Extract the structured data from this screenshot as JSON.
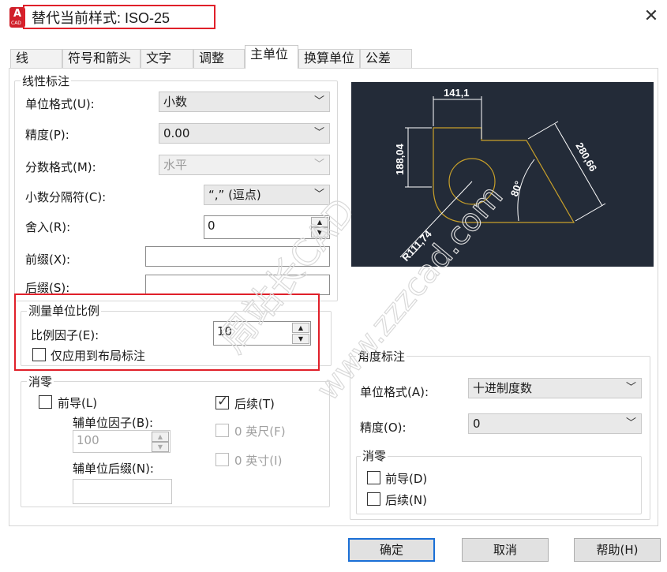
{
  "window": {
    "title": "替代当前样式: ISO-25",
    "app_icon_letter": "A",
    "app_icon_sub": "CAD",
    "close_glyph": "✕"
  },
  "tabs": [
    {
      "label": "线",
      "active": false
    },
    {
      "label": "符号和箭头",
      "active": false
    },
    {
      "label": "文字",
      "active": false
    },
    {
      "label": "调整",
      "active": false
    },
    {
      "label": "主单位",
      "active": true
    },
    {
      "label": "换算单位",
      "active": false
    },
    {
      "label": "公差",
      "active": false
    }
  ],
  "linear": {
    "title": "线性标注",
    "unit_format": {
      "label": "单位格式(U):",
      "value": "小数"
    },
    "precision": {
      "label": "精度(P):",
      "value": "0.00"
    },
    "fraction_format": {
      "label": "分数格式(M):",
      "value": "水平"
    },
    "decimal_separator": {
      "label": "小数分隔符(C):",
      "value": "“,” (逗点)"
    },
    "round_off": {
      "label": "舍入(R):",
      "value": "0"
    },
    "prefix": {
      "label": "前缀(X):",
      "value": ""
    },
    "suffix": {
      "label": "后缀(S):",
      "value": ""
    }
  },
  "scale": {
    "title": "测量单位比例",
    "factor": {
      "label": "比例因子(E):",
      "value": "10"
    },
    "layout_only": {
      "label": "仅应用到布局标注",
      "checked": false
    }
  },
  "zero_linear": {
    "title": "消零",
    "leading": {
      "label": "前导(L)",
      "checked": false
    },
    "trailing": {
      "label": "后续(T)",
      "checked": true
    },
    "sub_factor": {
      "label": "辅单位因子(B):",
      "value": "100"
    },
    "feet": {
      "label": "0 英尺(F)",
      "checked": false
    },
    "inches": {
      "label": "0 英寸(I)",
      "checked": false
    },
    "sub_suffix": {
      "label": "辅单位后缀(N):",
      "value": ""
    }
  },
  "preview": {
    "dim_top": "141,1",
    "dim_left": "188,04",
    "dim_right": "280,66",
    "dim_angle": "80°",
    "dim_radius": "R111,74"
  },
  "angular": {
    "title": "角度标注",
    "unit_format": {
      "label": "单位格式(A):",
      "value": "十进制度数"
    },
    "precision": {
      "label": "精度(O):",
      "value": "0"
    },
    "zero": {
      "title": "消零",
      "leading": {
        "label": "前导(D)",
        "checked": false
      },
      "trailing": {
        "label": "后续(N)",
        "checked": false
      }
    }
  },
  "buttons": {
    "ok": "确定",
    "cancel": "取消",
    "help": "帮助(H)"
  },
  "watermark": {
    "line1": "周站长CAD",
    "line2": "www.zzzcad.com"
  },
  "colors": {
    "accent_red": "#e0202a",
    "preview_bg": "#232b38",
    "preview_geometry": "#c8a02a",
    "default_button_border": "#1a6fd6"
  }
}
